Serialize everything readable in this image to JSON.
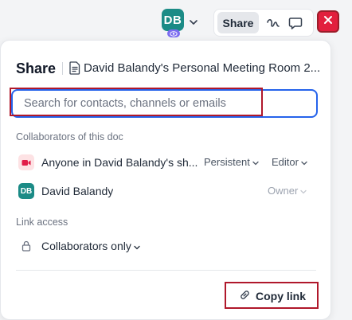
{
  "toolbar": {
    "avatar_initials": "DB",
    "share_label": "Share",
    "icons": [
      "chevron-down-icon",
      "eye-icon",
      "squiggle-icon",
      "comment-icon",
      "close-icon"
    ]
  },
  "dialog": {
    "title": "Share",
    "doc_name": "David Balandy's Personal Meeting Room 2...",
    "search": {
      "placeholder": "Search for contacts, channels or emails",
      "value": ""
    },
    "collaborators_label": "Collaborators of this doc",
    "collaborators": [
      {
        "name": "Anyone in David Balandy's sh...",
        "icon": "camera-icon",
        "duration": "Persistent",
        "role": "Editor"
      },
      {
        "name": "David Balandy",
        "avatar": "DB",
        "role": "Owner"
      }
    ],
    "link_access_label": "Link access",
    "link_access": {
      "value": "Collaborators only",
      "icon": "lock-icon"
    },
    "copy_link_label": "Copy link"
  },
  "colors": {
    "accent": "#2563eb",
    "avatar": "#1b8b86",
    "close": "#e21f3d",
    "highlight": "#b0182b",
    "meeting_icon_bg": "#fde2e4",
    "meeting_icon": "#e11d48"
  }
}
